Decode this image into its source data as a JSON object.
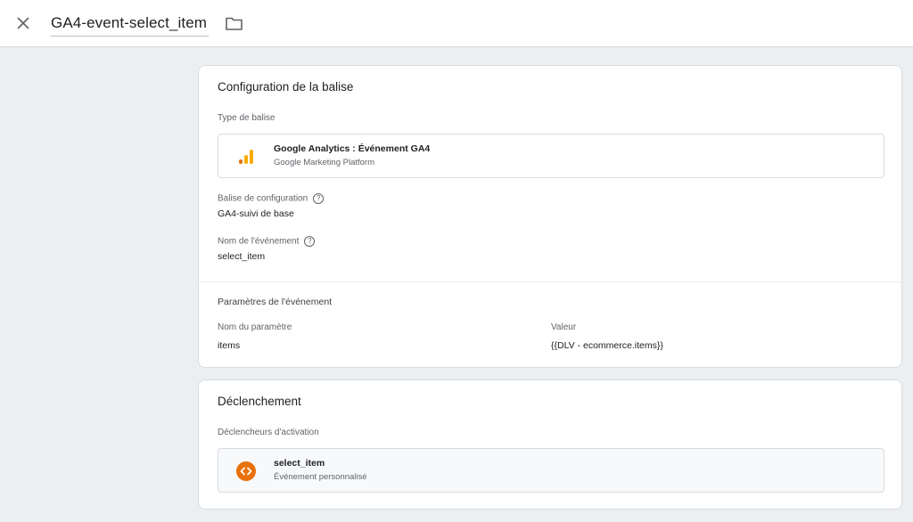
{
  "header": {
    "tag_name": "GA4-event-select_item"
  },
  "tag_config": {
    "title": "Configuration de la balise",
    "tag_type_label": "Type de balise",
    "tag_type": {
      "name": "Google Analytics : Événement GA4",
      "provider": "Google Marketing Platform",
      "icon": "analytics-bars-icon",
      "icon_color": "#f9ab00"
    },
    "config_tag_label": "Balise de configuration",
    "config_tag_value": "GA4-suivi de base",
    "event_name_label": "Nom de l'événement",
    "event_name_value": "select_item",
    "params_title": "Paramètres de l'événement",
    "params_columns": [
      "Nom du paramètre",
      "Valeur"
    ],
    "params_rows": [
      {
        "name": "items",
        "value": "{{DLV - ecommerce.items}}"
      }
    ]
  },
  "triggering": {
    "title": "Déclenchement",
    "firing_label": "Déclencheurs d'activation",
    "triggers": [
      {
        "name": "select_item",
        "type": "Événement personnalisé",
        "icon": "custom-event-icon",
        "icon_color": "#e8710a"
      }
    ]
  }
}
